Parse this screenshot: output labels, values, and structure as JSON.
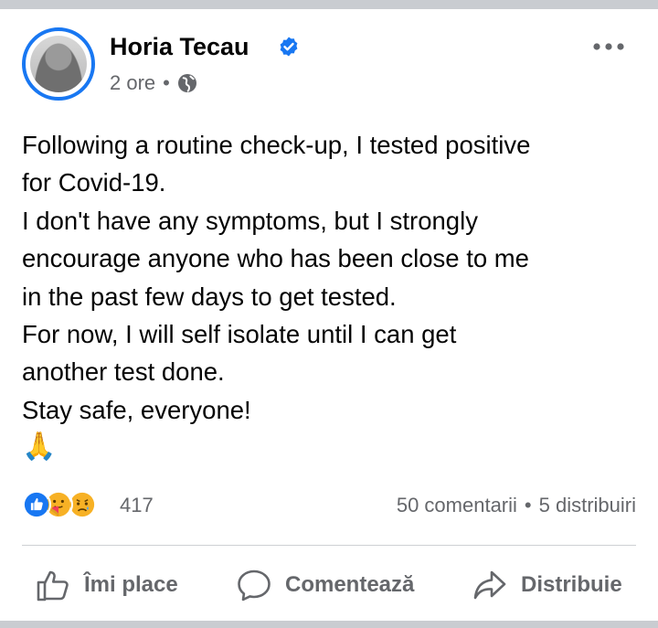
{
  "post": {
    "author": "Horia Tecau",
    "time": "2 ore",
    "separator": "•",
    "lines": [
      "Following a routine check-up, I tested positive",
      "for Covid-19.",
      "I don't have any symptoms, but I strongly",
      "encourage anyone who has been close to me",
      "in the past few days to get tested.",
      "For now, I will self isolate until I can get",
      "another test done.",
      "Stay safe, everyone!"
    ],
    "emoji": "🙏"
  },
  "stats": {
    "reactions_count": "417",
    "comments": "50 comentarii",
    "separator": "•",
    "shares": "5 distribuiri"
  },
  "actions": {
    "like": "Îmi place",
    "comment": "Comentează",
    "share": "Distribuie"
  },
  "colors": {
    "accent": "#1877f2",
    "secondary_text": "#65676b",
    "like_blue": "#1877f2",
    "care_yellow": "#f7b125",
    "care_red": "#f33e58"
  },
  "icons": [
    "verified-badge-icon",
    "globe-icon",
    "more-options-icon",
    "like-reaction-icon",
    "care-reaction-icon",
    "sad-reaction-icon",
    "thumbs-up-icon",
    "comment-bubble-icon",
    "share-arrow-icon"
  ]
}
